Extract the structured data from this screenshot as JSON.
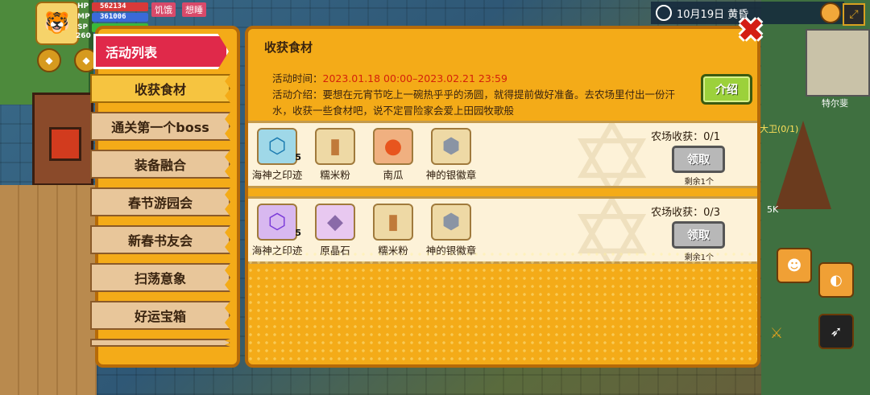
{
  "hud": {
    "hp_label": "HP",
    "hp_value": "562134",
    "mp_label": "MP",
    "mp_value": "361006",
    "sp_label": "SP",
    "level": "260",
    "status_hungry": "饥饿",
    "status_sleepy": "想睡",
    "date": "10月19日",
    "time_of_day": "黄昏",
    "map_name": "特尔斐",
    "npc_label": "大卫(0/1)",
    "coord": "5K"
  },
  "sidebar": {
    "header": "活动列表",
    "items": [
      {
        "label": "收获食材",
        "active": true
      },
      {
        "label": "通关第一个boss"
      },
      {
        "label": "装备融合"
      },
      {
        "label": "春节游园会"
      },
      {
        "label": "新春书友会"
      },
      {
        "label": "扫荡意象"
      },
      {
        "label": "好运宝箱"
      }
    ]
  },
  "panel": {
    "title": "收获食材",
    "time_label": "活动时间：",
    "time_value": "2023.01.18 00:00–2023.02.21 23:59",
    "intro_label": "活动介绍：",
    "intro_text": "要想在元宵节吃上一碗热乎乎的汤圆，就得提前做好准备。去农场里付出一份汗水，收获一些食材吧，说不定冒险家会爱上田园牧歌般",
    "intro_button": "介绍"
  },
  "rewards": [
    {
      "items": [
        {
          "name": "海神之印迹",
          "count": "5",
          "icon": "blue-seal-icon",
          "color": "#3ab6d8"
        },
        {
          "name": "糯米粉",
          "count": "",
          "icon": "flour-sack-icon",
          "color": "#c07a3a"
        },
        {
          "name": "南瓜",
          "count": "",
          "icon": "pumpkin-icon",
          "color": "#e8551e"
        },
        {
          "name": "神的银徽章",
          "count": "",
          "icon": "silver-badge-icon",
          "color": "#c8ccd4"
        }
      ],
      "progress": "农场收获：0/1",
      "claim": "领取",
      "remain": "剩余1个"
    },
    {
      "items": [
        {
          "name": "海神之印迹",
          "count": "5",
          "icon": "purple-seal-icon",
          "color": "#7a3ad8"
        },
        {
          "name": "原晶石",
          "count": "",
          "icon": "crystal-icon",
          "color": "#b48ac8"
        },
        {
          "name": "糯米粉",
          "count": "",
          "icon": "flour-sack-icon",
          "color": "#c07a3a"
        },
        {
          "name": "神的银徽章",
          "count": "",
          "icon": "silver-badge-icon",
          "color": "#c8ccd4"
        }
      ],
      "progress": "农场收获：0/3",
      "claim": "领取",
      "remain": "剩余1个"
    }
  ]
}
